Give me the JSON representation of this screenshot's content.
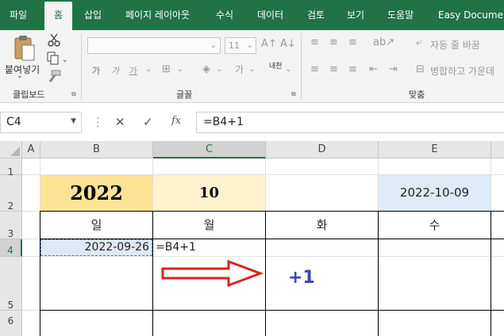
{
  "tabs": [
    "파일",
    "홈",
    "삽입",
    "페이지 레이아웃",
    "수식",
    "데이터",
    "검토",
    "보기",
    "도움말",
    "Easy Document"
  ],
  "ribbon": {
    "clipboard": {
      "paste_label_1": "붙여넣기",
      "paste_label_2": "",
      "group_label": "클립보드"
    },
    "font": {
      "font_name": "",
      "font_size": "11",
      "bold": "가",
      "italic": "가",
      "underline": "가",
      "phonetic": "내천",
      "group_label": "글꼴"
    },
    "alignment": {
      "wrap_text": "자동 줄 바꿈",
      "merge_center": "병합하고 가운데",
      "group_label": "맞춤"
    }
  },
  "formula_bar": {
    "name_box": "C4",
    "cancel": "✕",
    "enter": "✓",
    "fx": "fx",
    "formula": "=B4+1"
  },
  "columns": [
    "A",
    "B",
    "C",
    "D",
    "E"
  ],
  "rows": [
    "1",
    "2",
    "3",
    "4",
    "5",
    "6"
  ],
  "cells": {
    "B2": "2022",
    "C2": "10",
    "E2": "2022-10-09",
    "B3": "일",
    "C3": "월",
    "D3": "화",
    "E3": "수",
    "B4": "2022-09-26",
    "C4": "=B4+1"
  },
  "annotation": {
    "text": "+1",
    "arrow_color": "#e02020",
    "text_color": "#3a45b0"
  },
  "colors": {
    "accent": "#217346",
    "year_fill": "#fde394",
    "month_fill": "#fff2cc",
    "date_fill": "#dcebf7",
    "selected_fill": "#dfe8f5"
  }
}
